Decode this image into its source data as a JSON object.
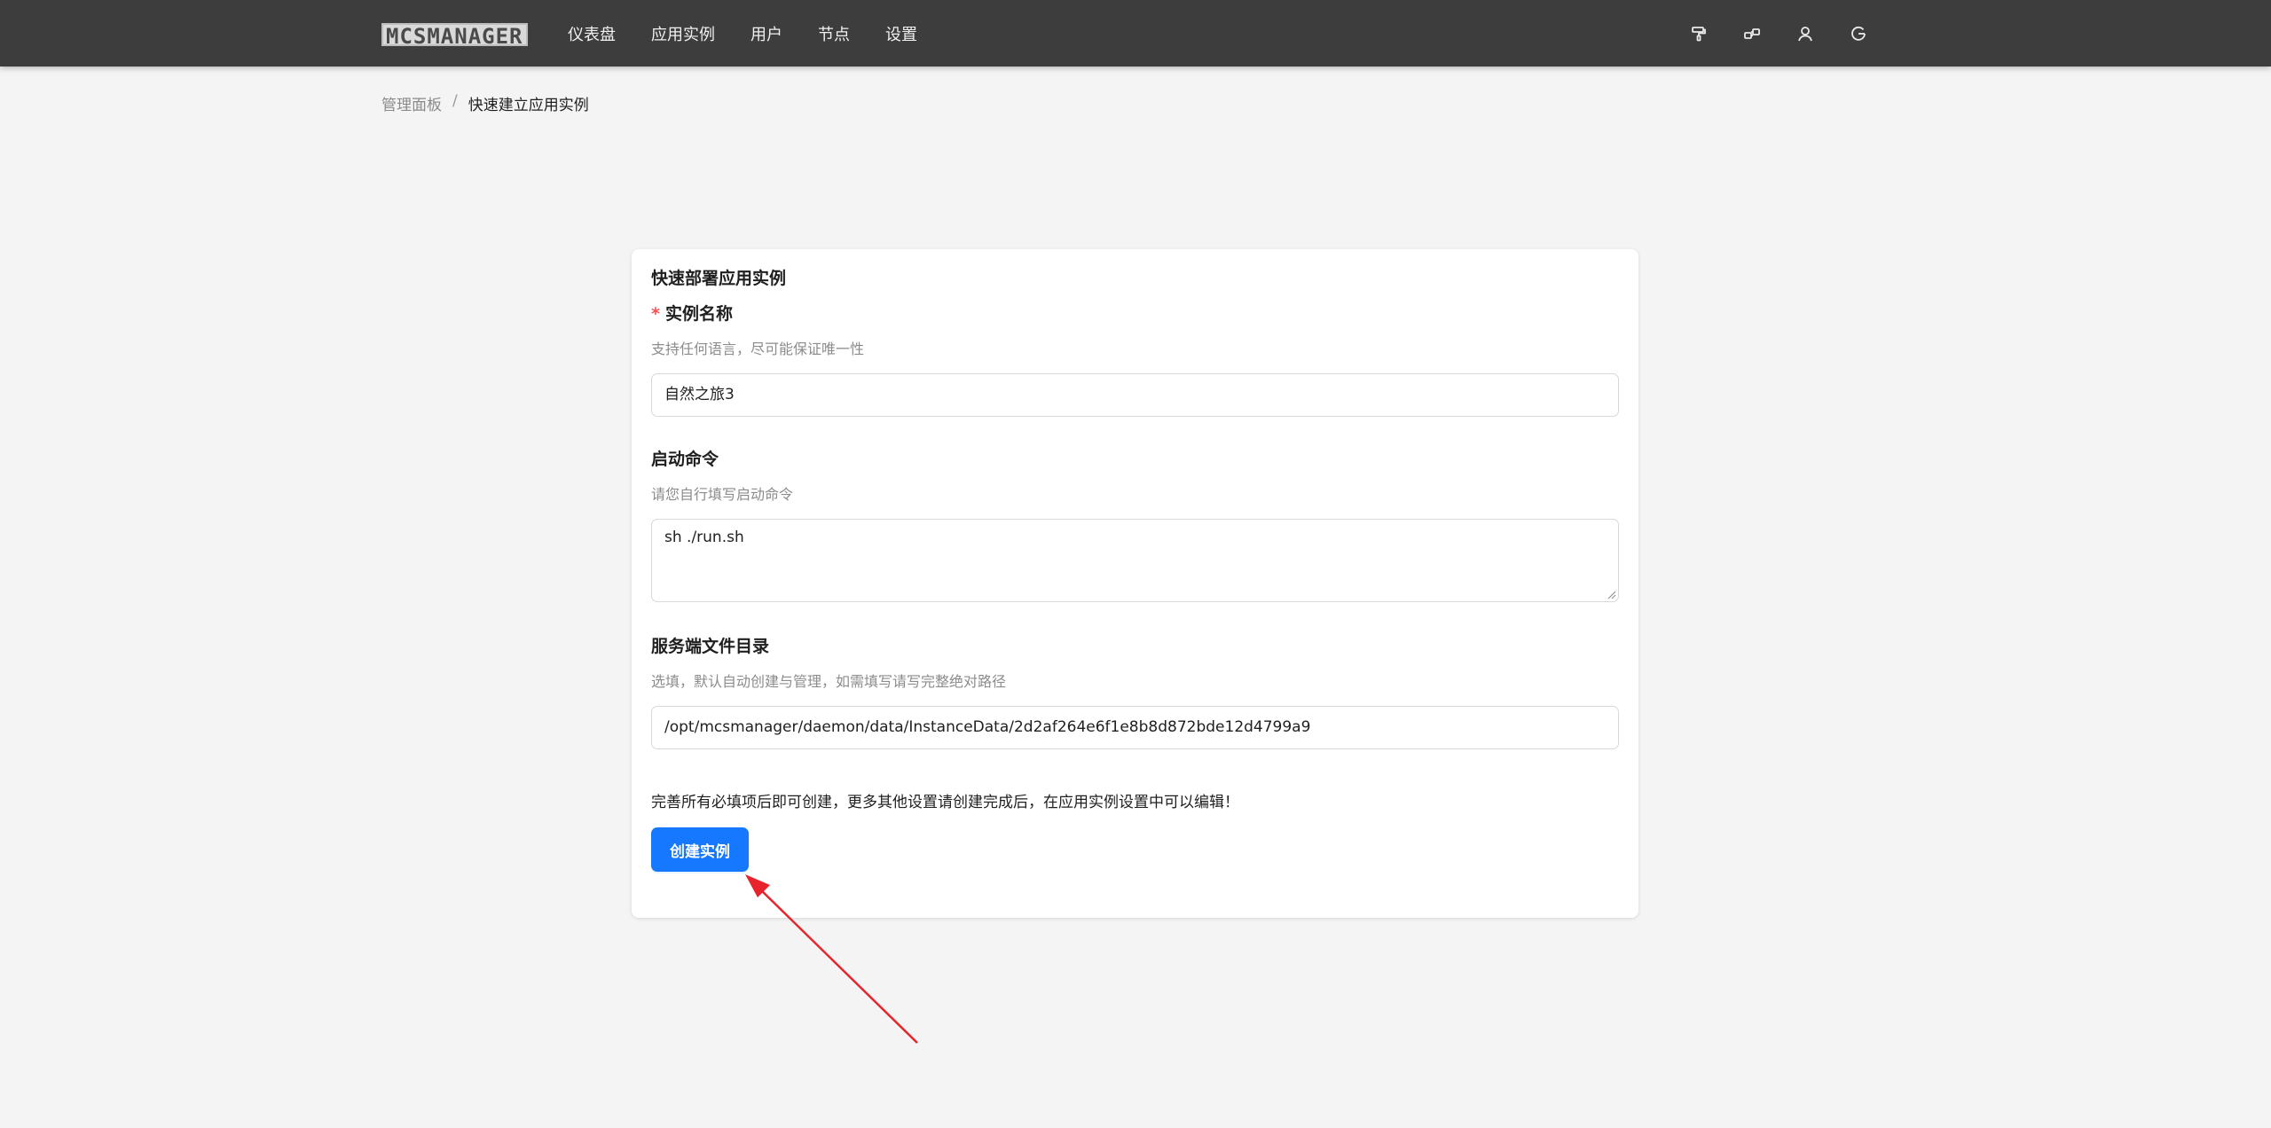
{
  "header": {
    "logo": "MCSMANAGER",
    "nav": [
      "仪表盘",
      "应用实例",
      "用户",
      "节点",
      "设置"
    ],
    "icons": [
      "paint-roller-icon",
      "layout-icon",
      "user-icon",
      "logout-icon"
    ]
  },
  "breadcrumb": {
    "prev": "管理面板",
    "separator": "/",
    "current": "快速建立应用实例"
  },
  "card": {
    "title": "快速部署应用实例",
    "name_field": {
      "required_mark": "*",
      "label": "实例名称",
      "hint": "支持任何语言，尽可能保证唯一性",
      "value": "自然之旅3"
    },
    "command_field": {
      "label": "启动命令",
      "hint": "请您自行填写启动命令",
      "value": "sh ./run.sh"
    },
    "dir_field": {
      "label": "服务端文件目录",
      "hint": "选填，默认自动创建与管理，如需填写请写完整绝对路径",
      "value": "/opt/mcsmanager/daemon/data/InstanceData/2d2af264e6f1e8b8d872bde12d4799a9"
    },
    "notice": "完善所有必填项后即可创建，更多其他设置请创建完成后，在应用实例设置中可以编辑！",
    "create_button": "创建实例"
  },
  "colors": {
    "topbar": "#3d3d3d",
    "primary": "#1677ff",
    "annotation_arrow": "#e8232b"
  }
}
